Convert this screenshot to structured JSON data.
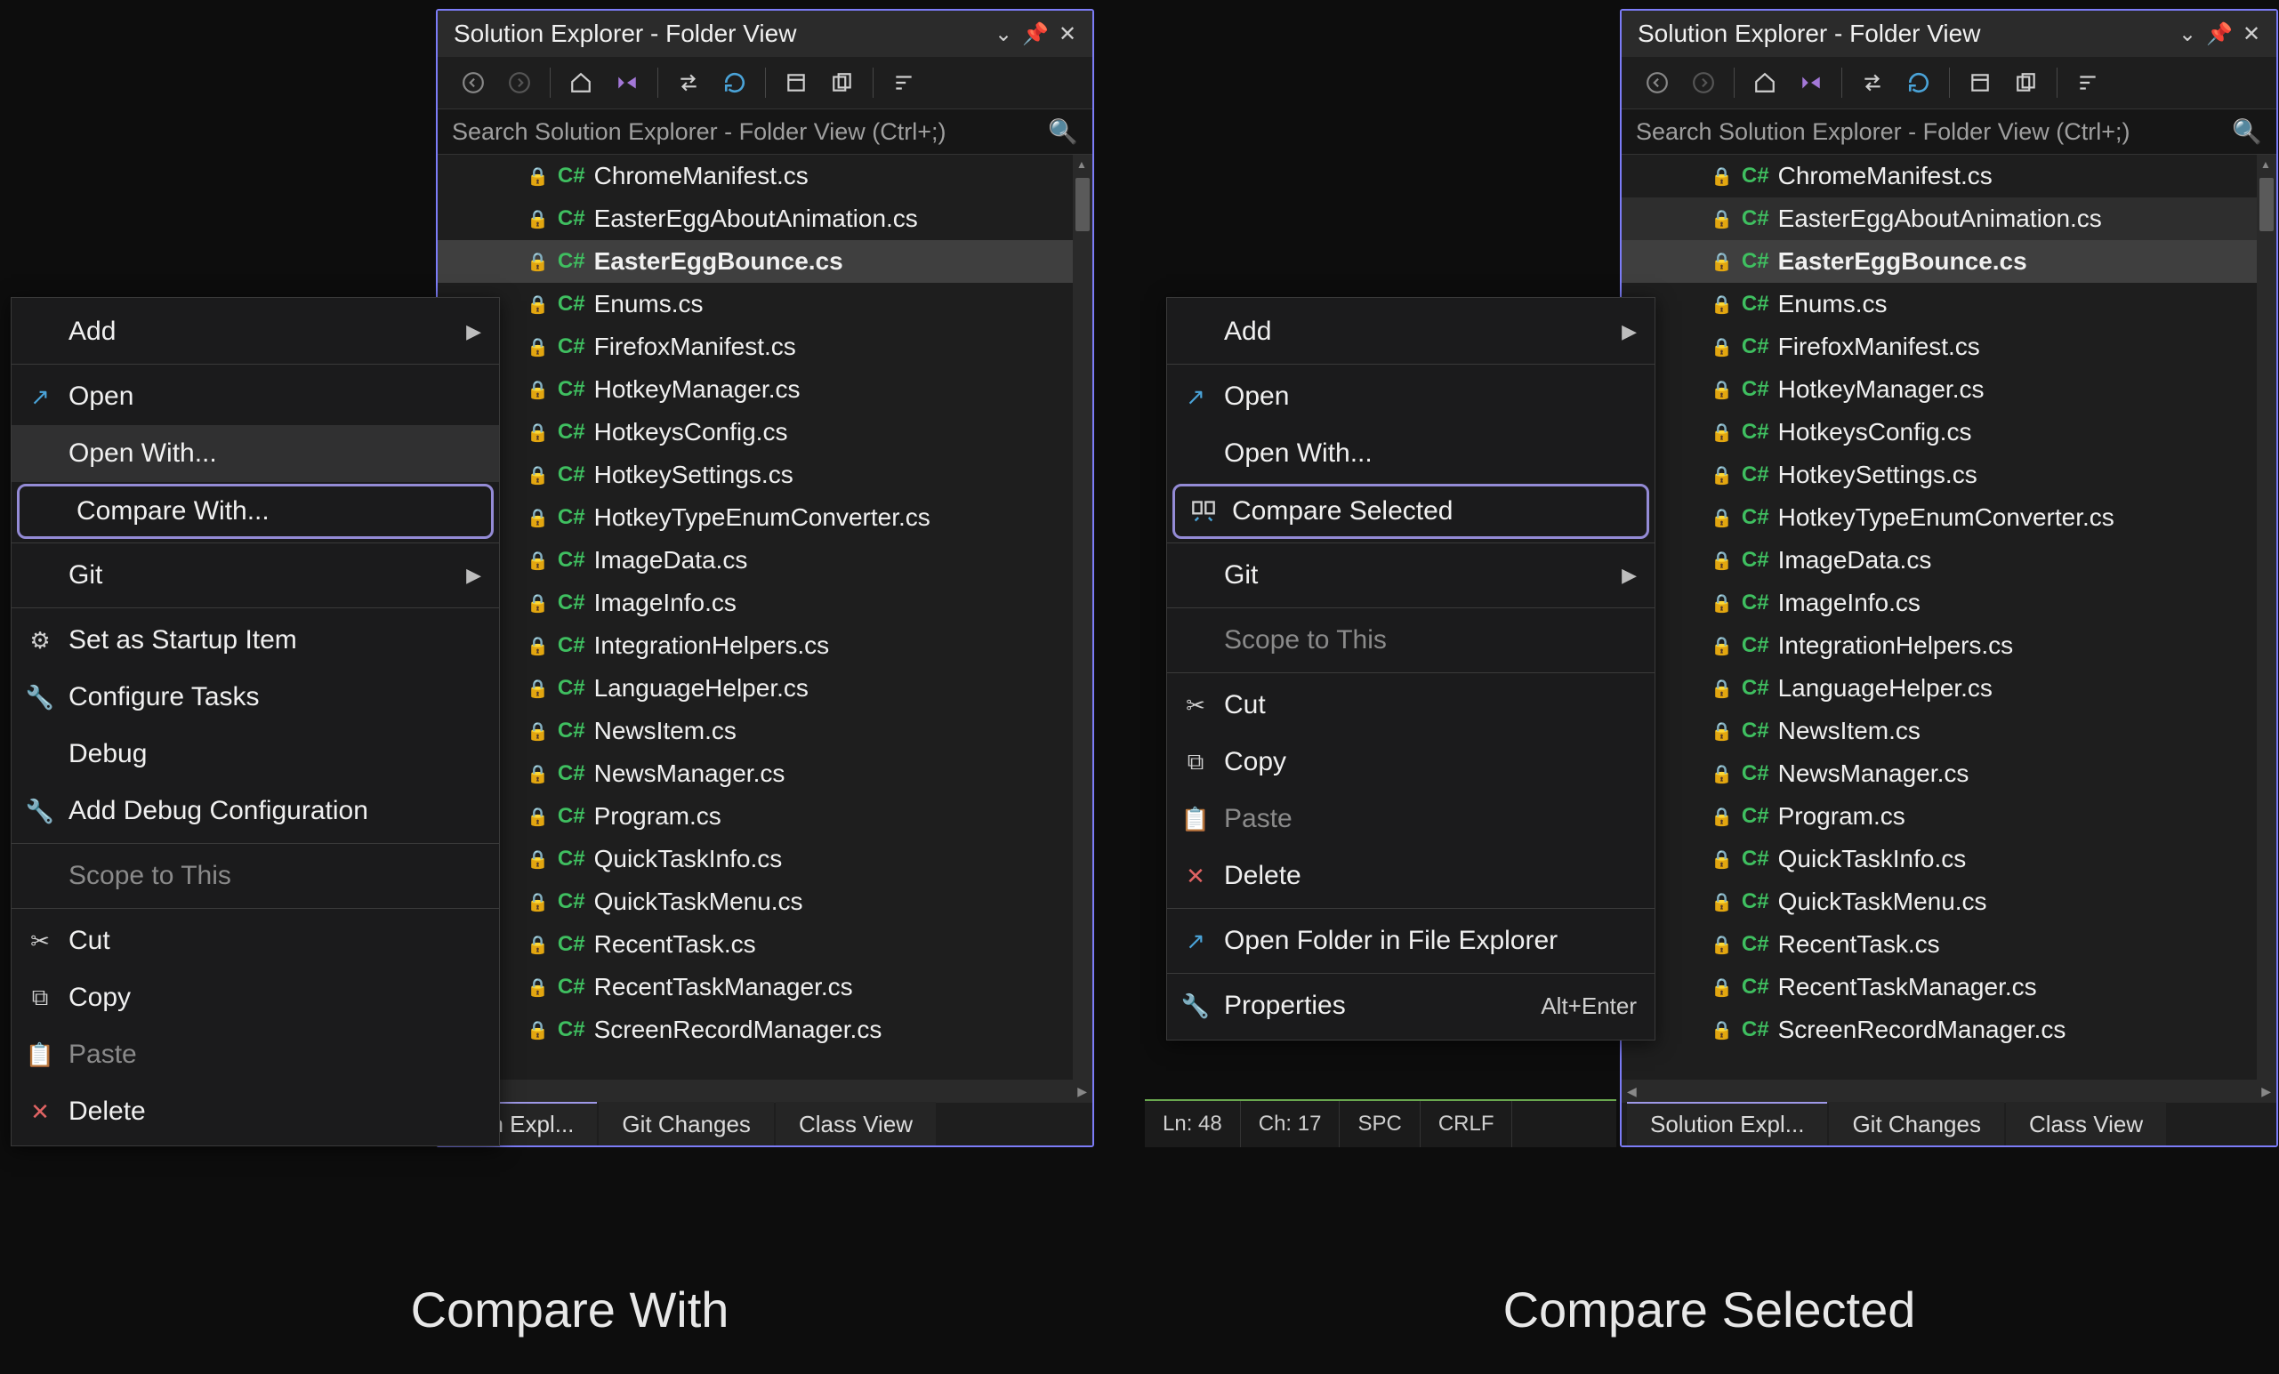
{
  "captions": {
    "left": "Compare With",
    "right": "Compare Selected"
  },
  "explorer": {
    "title": "Solution Explorer - Folder View",
    "search_placeholder": "Search Solution Explorer - Folder View (Ctrl+;)",
    "files": [
      "ChromeManifest.cs",
      "EasterEggAboutAnimation.cs",
      "EasterEggBounce.cs",
      "Enums.cs",
      "FirefoxManifest.cs",
      "HotkeyManager.cs",
      "HotkeysConfig.cs",
      "HotkeySettings.cs",
      "HotkeyTypeEnumConverter.cs",
      "ImageData.cs",
      "ImageInfo.cs",
      "IntegrationHelpers.cs",
      "LanguageHelper.cs",
      "NewsItem.cs",
      "NewsManager.cs",
      "Program.cs",
      "QuickTaskInfo.cs",
      "QuickTaskMenu.cs",
      "RecentTask.cs",
      "RecentTaskManager.cs",
      "ScreenRecordManager.cs"
    ],
    "selected_left": [
      2
    ],
    "selected_right_hard": [
      2
    ],
    "selected_right_soft": [
      1
    ],
    "tabs_left": {
      "active": "tion Expl...",
      "t2": "Git Changes",
      "t3": "Class View"
    },
    "tabs_right": {
      "active": "Solution Expl...",
      "t2": "Git Changes",
      "t3": "Class View"
    }
  },
  "status": {
    "ln": "Ln: 48",
    "ch": "Ch: 17",
    "spc": "SPC",
    "crlf": "CRLF"
  },
  "menu_left": {
    "add": "Add",
    "open": "Open",
    "open_with": "Open With...",
    "compare_with": "Compare With...",
    "git": "Git",
    "startup": "Set as Startup Item",
    "cfg_tasks": "Configure Tasks",
    "debug": "Debug",
    "add_debug": "Add Debug Configuration",
    "scope": "Scope to This",
    "cut": "Cut",
    "copy": "Copy",
    "paste": "Paste",
    "delete": "Delete"
  },
  "menu_right": {
    "add": "Add",
    "open": "Open",
    "open_with": "Open With...",
    "compare_selected": "Compare Selected",
    "git": "Git",
    "scope": "Scope to This",
    "cut": "Cut",
    "copy": "Copy",
    "paste": "Paste",
    "delete": "Delete",
    "open_folder": "Open Folder in File Explorer",
    "properties": "Properties",
    "properties_short": "Alt+Enter"
  }
}
